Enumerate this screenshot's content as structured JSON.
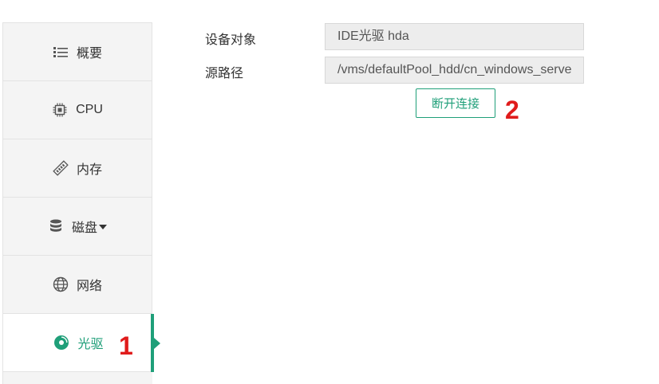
{
  "sidebar": {
    "items": [
      {
        "label": "概要",
        "icon": "list-icon"
      },
      {
        "label": "CPU",
        "icon": "cpu-chip-icon"
      },
      {
        "label": "内存",
        "icon": "memory-stick-icon"
      },
      {
        "label": "磁盘",
        "icon": "database-icon",
        "has_dropdown": true
      },
      {
        "label": "网络",
        "icon": "globe-icon"
      },
      {
        "label": "光驱",
        "icon": "disc-icon",
        "active": true
      }
    ]
  },
  "form": {
    "device_label": "设备对象",
    "device_value": "IDE光驱 hda",
    "source_label": "源路径",
    "source_value": "/vms/defaultPool_hdd/cn_windows_serve"
  },
  "actions": {
    "disconnect_label": "断开连接"
  },
  "annotations": {
    "marker_1": "1",
    "marker_2": "2"
  },
  "colors": {
    "accent": "#1f9f79",
    "marker": "#e01b1b",
    "sidebar_bg": "#f4f4f4",
    "field_bg": "#ededed"
  }
}
